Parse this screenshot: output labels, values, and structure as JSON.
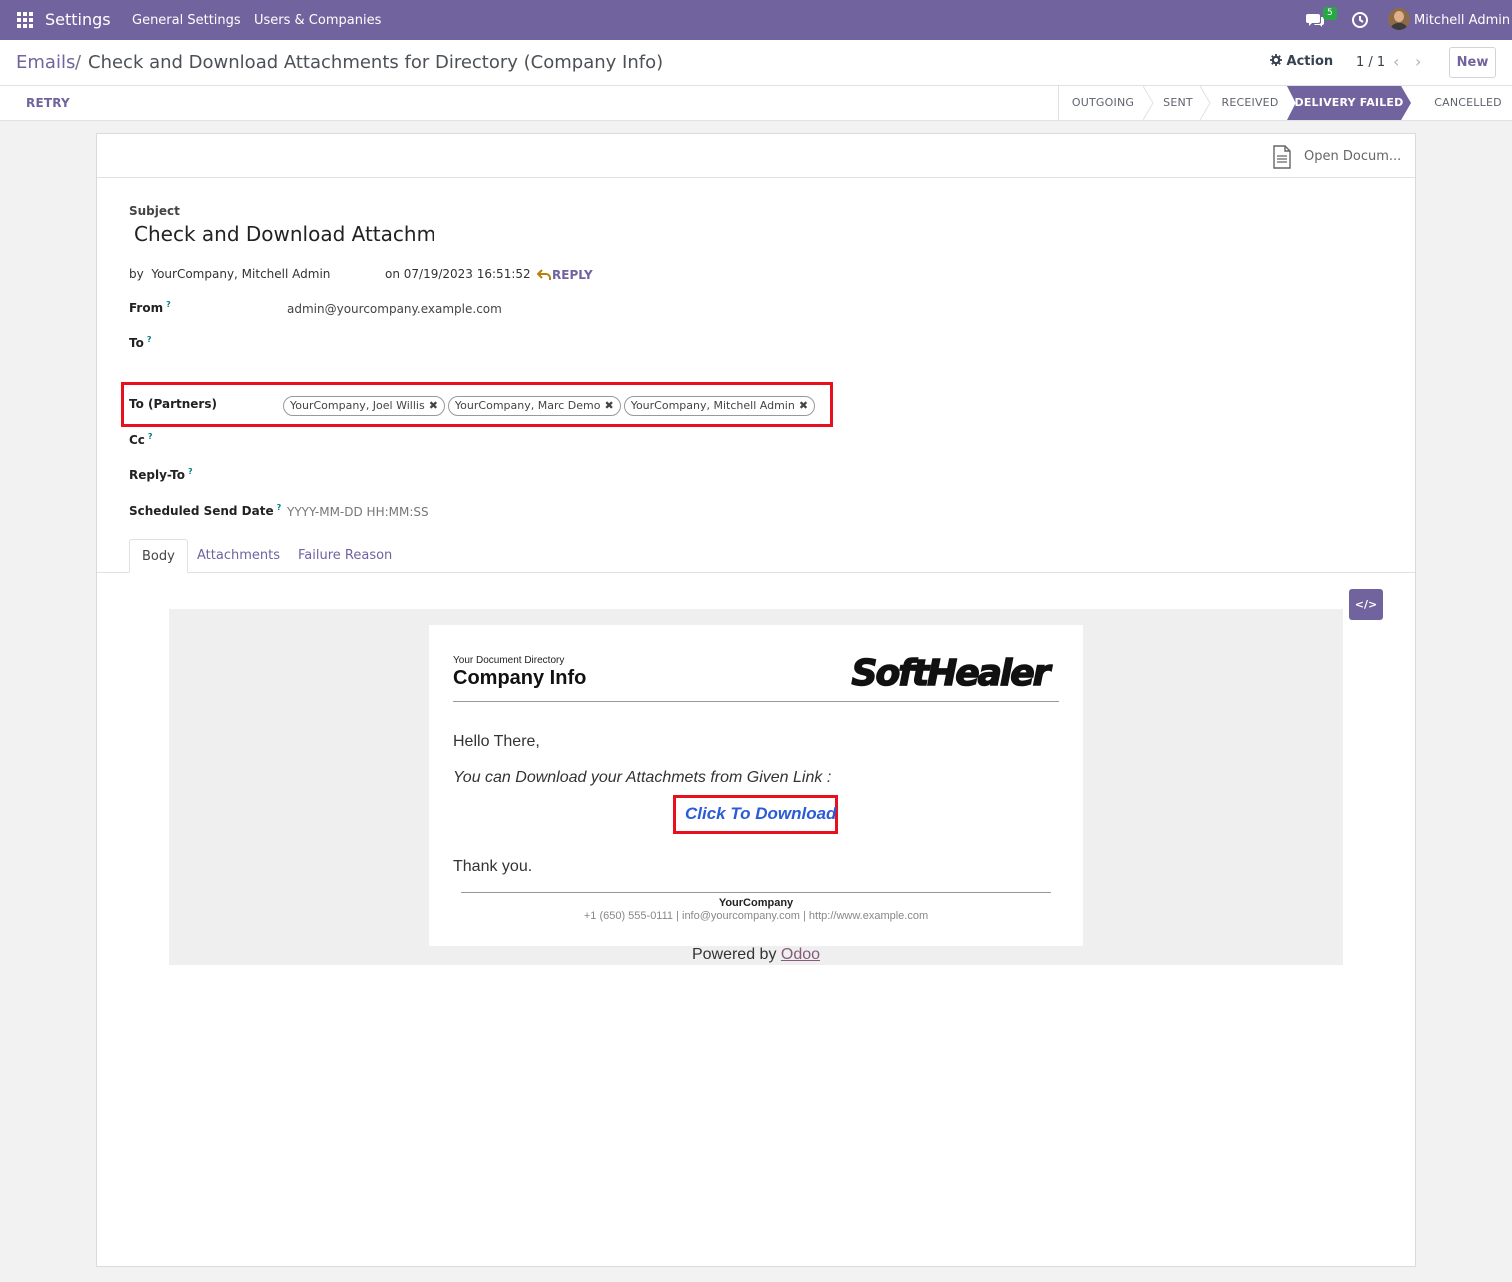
{
  "navbar": {
    "app_name": "Settings",
    "menu": [
      "General Settings",
      "Users & Companies"
    ],
    "chat_badge": "5",
    "user_name": "Mitchell Admin"
  },
  "breadcrumb": {
    "parent": "Emails",
    "separator": "/",
    "current": "Check and Download Attachments for Directory (Company Info)"
  },
  "control": {
    "action_label": "Action",
    "pager": "1 / 1",
    "new_label": "New"
  },
  "statusbar": {
    "retry_label": "RETRY",
    "states": [
      "OUTGOING",
      "SENT",
      "RECEIVED",
      "DELIVERY FAILED",
      "CANCELLED"
    ],
    "active_state": "DELIVERY FAILED"
  },
  "sheet": {
    "open_document_label": "Open Docum...",
    "subject_label": "Subject",
    "subject_value": "Check and Download Attachments for Directory (Company Info)",
    "by_line": "by  YourCompany, Mitchell Admin",
    "on_line": "on 07/19/2023 16:51:52",
    "reply_label": "REPLY",
    "fields": {
      "from_label": "From",
      "from_value": "admin@yourcompany.example.com",
      "to_label": "To",
      "to_partners_label": "To (Partners)",
      "partners": [
        "YourCompany, Joel Willis",
        "YourCompany, Marc Demo",
        "YourCompany, Mitchell Admin"
      ],
      "cc_label": "Cc",
      "reply_to_label": "Reply-To",
      "scheduled_label": "Scheduled Send Date",
      "scheduled_placeholder": "YYYY-MM-DD HH:MM:SS",
      "help_mark": "?"
    },
    "tabs": [
      "Body",
      "Attachments",
      "Failure Reason"
    ],
    "active_tab": "Body"
  },
  "email": {
    "directory_subtitle": "Your Document Directory",
    "directory_title": "Company Info",
    "logo_text": "SoftHealer",
    "greeting": "Hello There,",
    "download_text": "You can Download your Attachmets from Given Link :",
    "download_link": "Click To Download",
    "thanks": "Thank you.",
    "footer_company": "YourCompany",
    "footer_info": "+1 (650) 555-0111 | info@yourcompany.com | http://www.example.com",
    "powered_by": "Powered by",
    "powered_link": "Odoo"
  },
  "colors": {
    "brand": "#71639e",
    "highlight": "#e8101e",
    "link_blue": "#2b5bd7"
  },
  "icons": [
    "apps-grid-icon",
    "chat-icon",
    "clock-icon",
    "gear-icon",
    "chevron-left-icon",
    "chevron-right-icon",
    "document-icon",
    "reply-icon",
    "remove-tag-icon",
    "code-view-icon"
  ]
}
